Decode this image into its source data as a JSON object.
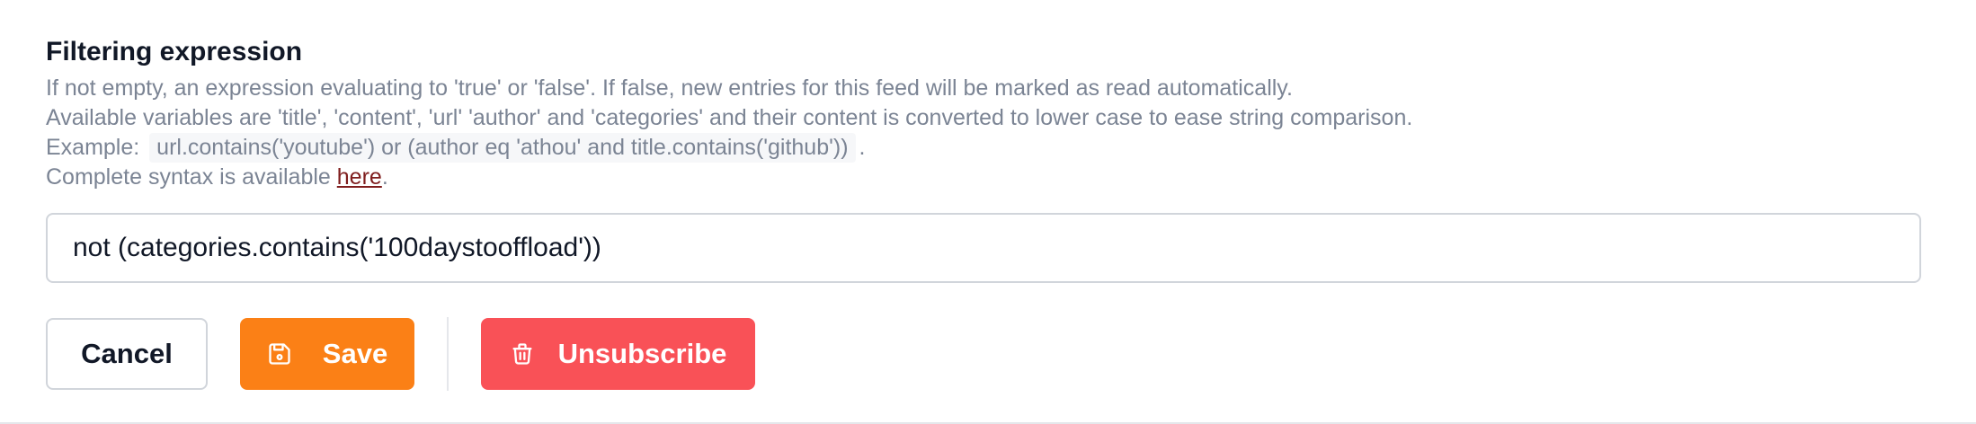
{
  "filter": {
    "label": "Filtering expression",
    "help_line1": "If not empty, an expression evaluating to 'true' or 'false'. If false, new entries for this feed will be marked as read automatically.",
    "help_line2": "Available variables are 'title', 'content', 'url' 'author' and 'categories' and their content is converted to lower case to ease string comparison.",
    "example_prefix": "Example:",
    "example_code": "url.contains('youtube') or (author eq 'athou' and title.contains('github'))",
    "example_suffix": ".",
    "syntax_prefix": "Complete syntax is available ",
    "syntax_link": "here",
    "syntax_suffix": ".",
    "value": "not (categories.contains('100daystooffload'))"
  },
  "actions": {
    "cancel_label": "Cancel",
    "save_label": "Save",
    "save_icon": "floppy-disk-icon",
    "unsubscribe_label": "Unsubscribe",
    "unsubscribe_icon": "trash-icon"
  },
  "colors": {
    "save": "#fb8016",
    "unsubscribe": "#f95157",
    "link": "#7f1d1d"
  }
}
